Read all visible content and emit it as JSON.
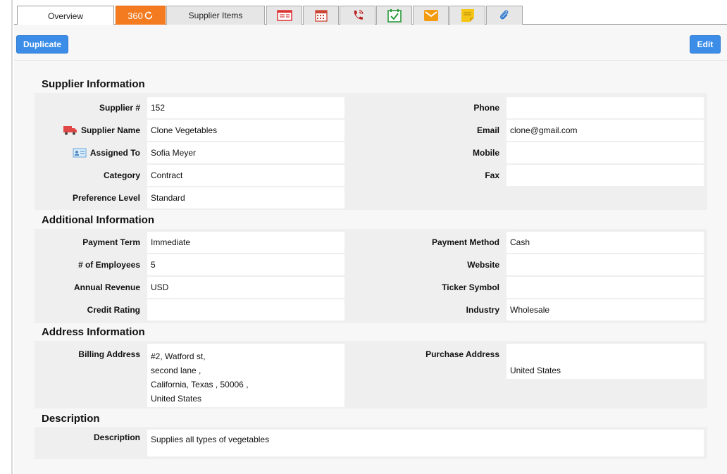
{
  "tabs": [
    {
      "label": "Overview",
      "type": "text"
    },
    {
      "label": "360",
      "type": "badge"
    },
    {
      "label": "Supplier Items",
      "type": "text"
    },
    {
      "icon": "report-icon"
    },
    {
      "icon": "calendar-icon"
    },
    {
      "icon": "phone-icon"
    },
    {
      "icon": "task-icon"
    },
    {
      "icon": "mail-icon"
    },
    {
      "icon": "note-icon"
    },
    {
      "icon": "attachment-icon"
    }
  ],
  "toolbar": {
    "duplicate": "Duplicate",
    "edit": "Edit"
  },
  "sections": {
    "supplier": "Supplier Information",
    "additional": "Additional Information",
    "address": "Address Information",
    "description": "Description"
  },
  "supplier": {
    "number_label": "Supplier #",
    "number": "152",
    "name_label": "Supplier Name",
    "name": "Clone Vegetables",
    "assigned_label": "Assigned To",
    "assigned": "Sofia Meyer",
    "category_label": "Category",
    "category": "Contract",
    "preference_label": "Preference Level",
    "preference": "Standard",
    "phone_label": "Phone",
    "phone": "",
    "email_label": "Email",
    "email": "clone@gmail.com",
    "mobile_label": "Mobile",
    "mobile": "",
    "fax_label": "Fax",
    "fax": ""
  },
  "additional": {
    "payment_term_label": "Payment Term",
    "payment_term": "Immediate",
    "employees_label": "# of Employees",
    "employees": "5",
    "revenue_label": "Annual Revenue",
    "revenue": "USD",
    "credit_label": "Credit Rating",
    "credit": "",
    "payment_method_label": "Payment Method",
    "payment_method": "Cash",
    "website_label": "Website",
    "website": "",
    "ticker_label": "Ticker Symbol",
    "ticker": "",
    "industry_label": "Industry",
    "industry": "Wholesale"
  },
  "address": {
    "billing_label": "Billing Address",
    "billing": [
      "#2, Watford st,",
      "second lane ,",
      "California, Texas , 50006 ,",
      "United States"
    ],
    "purchase_label": "Purchase Address",
    "purchase": [
      "",
      "United States"
    ]
  },
  "description": {
    "label": "Description",
    "text": "Supplies all types of vegetables"
  },
  "colors": {
    "accent": "#3b8de8",
    "tab_360": "#f47b20"
  }
}
